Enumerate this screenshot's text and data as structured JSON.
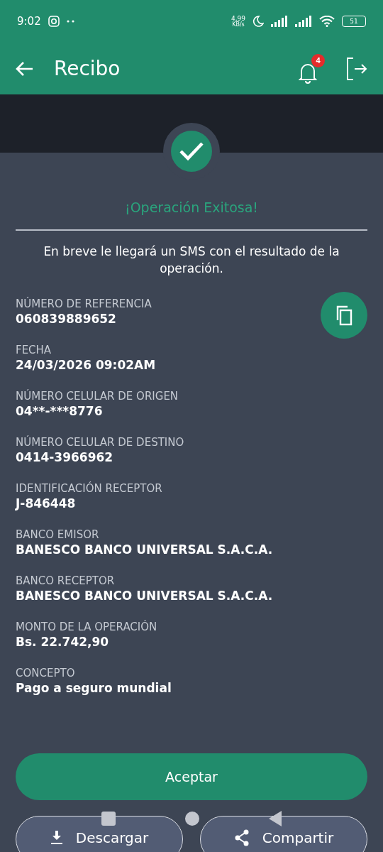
{
  "status_bar": {
    "time": "9:02",
    "speed": "4,99",
    "speed_unit": "KB/s",
    "battery": "51"
  },
  "app_bar": {
    "title": "Recibo",
    "notification_count": "4"
  },
  "result": {
    "title": "¡Operación Exitosa!",
    "message": "En breve le llegará un SMS con el resultado de la operación."
  },
  "fields": [
    {
      "label": "NÚMERO DE REFERENCIA",
      "value": "060839889652"
    },
    {
      "label": "FECHA",
      "value": "24/03/2026 09:02AM"
    },
    {
      "label": "NÚMERO CELULAR DE ORIGEN",
      "value": "04**-***8776"
    },
    {
      "label": "NÚMERO CELULAR DE DESTINO",
      "value": "0414-3966962"
    },
    {
      "label": "IDENTIFICACIÓN RECEPTOR",
      "value": "J-846448"
    },
    {
      "label": "BANCO EMISOR",
      "value": "BANESCO BANCO UNIVERSAL S.A.C.A."
    },
    {
      "label": "BANCO RECEPTOR",
      "value": "BANESCO BANCO UNIVERSAL S.A.C.A."
    },
    {
      "label": "MONTO DE LA OPERACIÓN",
      "value": "Bs. 22.742,90"
    },
    {
      "label": "CONCEPTO",
      "value": "Pago a seguro mundial"
    }
  ],
  "primary_button": "Aceptar",
  "secondary_buttons": [
    {
      "kind": "download",
      "label": "Descargar"
    },
    {
      "kind": "share",
      "label": "Compartir"
    }
  ]
}
